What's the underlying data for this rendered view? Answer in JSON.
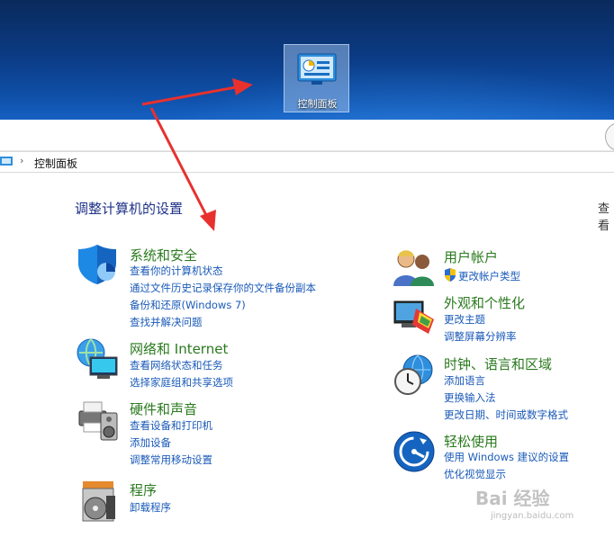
{
  "desktop": {
    "icon_label": "控制面板"
  },
  "address_bar": {
    "breadcrumb": "控制面板"
  },
  "main": {
    "heading": "调整计算机的设置",
    "view_by_label": "查看"
  },
  "categories_left": [
    {
      "title": "系统和安全",
      "icon": "shield-icon",
      "links": [
        "查看你的计算机状态",
        "通过文件历史记录保存你的文件备份副本",
        "备份和还原(Windows 7)",
        "查找并解决问题"
      ]
    },
    {
      "title": "网络和 Internet",
      "icon": "network-globe-icon",
      "links": [
        "查看网络状态和任务",
        "选择家庭组和共享选项"
      ]
    },
    {
      "title": "硬件和声音",
      "icon": "printer-speaker-icon",
      "links": [
        "查看设备和打印机",
        "添加设备",
        "调整常用移动设置"
      ]
    },
    {
      "title": "程序",
      "icon": "programs-disc-icon",
      "links": [
        "卸载程序"
      ]
    }
  ],
  "categories_right": [
    {
      "title": "用户帐户",
      "icon": "users-icon",
      "links": [
        "更改帐户类型"
      ]
    },
    {
      "title": "外观和个性化",
      "icon": "monitor-palette-icon",
      "links": [
        "更改主题",
        "调整屏幕分辨率"
      ]
    },
    {
      "title": "时钟、语言和区域",
      "icon": "clock-globe-icon",
      "links": [
        "添加语言",
        "更换输入法",
        "更改日期、时间或数字格式"
      ]
    },
    {
      "title": "轻松使用",
      "icon": "ease-of-access-icon",
      "links": [
        "使用 Windows 建议的设置",
        "优化视觉显示"
      ]
    }
  ],
  "watermark": {
    "text": "Bai 经验",
    "sub": "jingyan.baidu.com"
  },
  "colors": {
    "category_title": "#2a7a1e",
    "link": "#1a5ab8",
    "heading": "#1e3287",
    "arrow": "#e8312d"
  }
}
